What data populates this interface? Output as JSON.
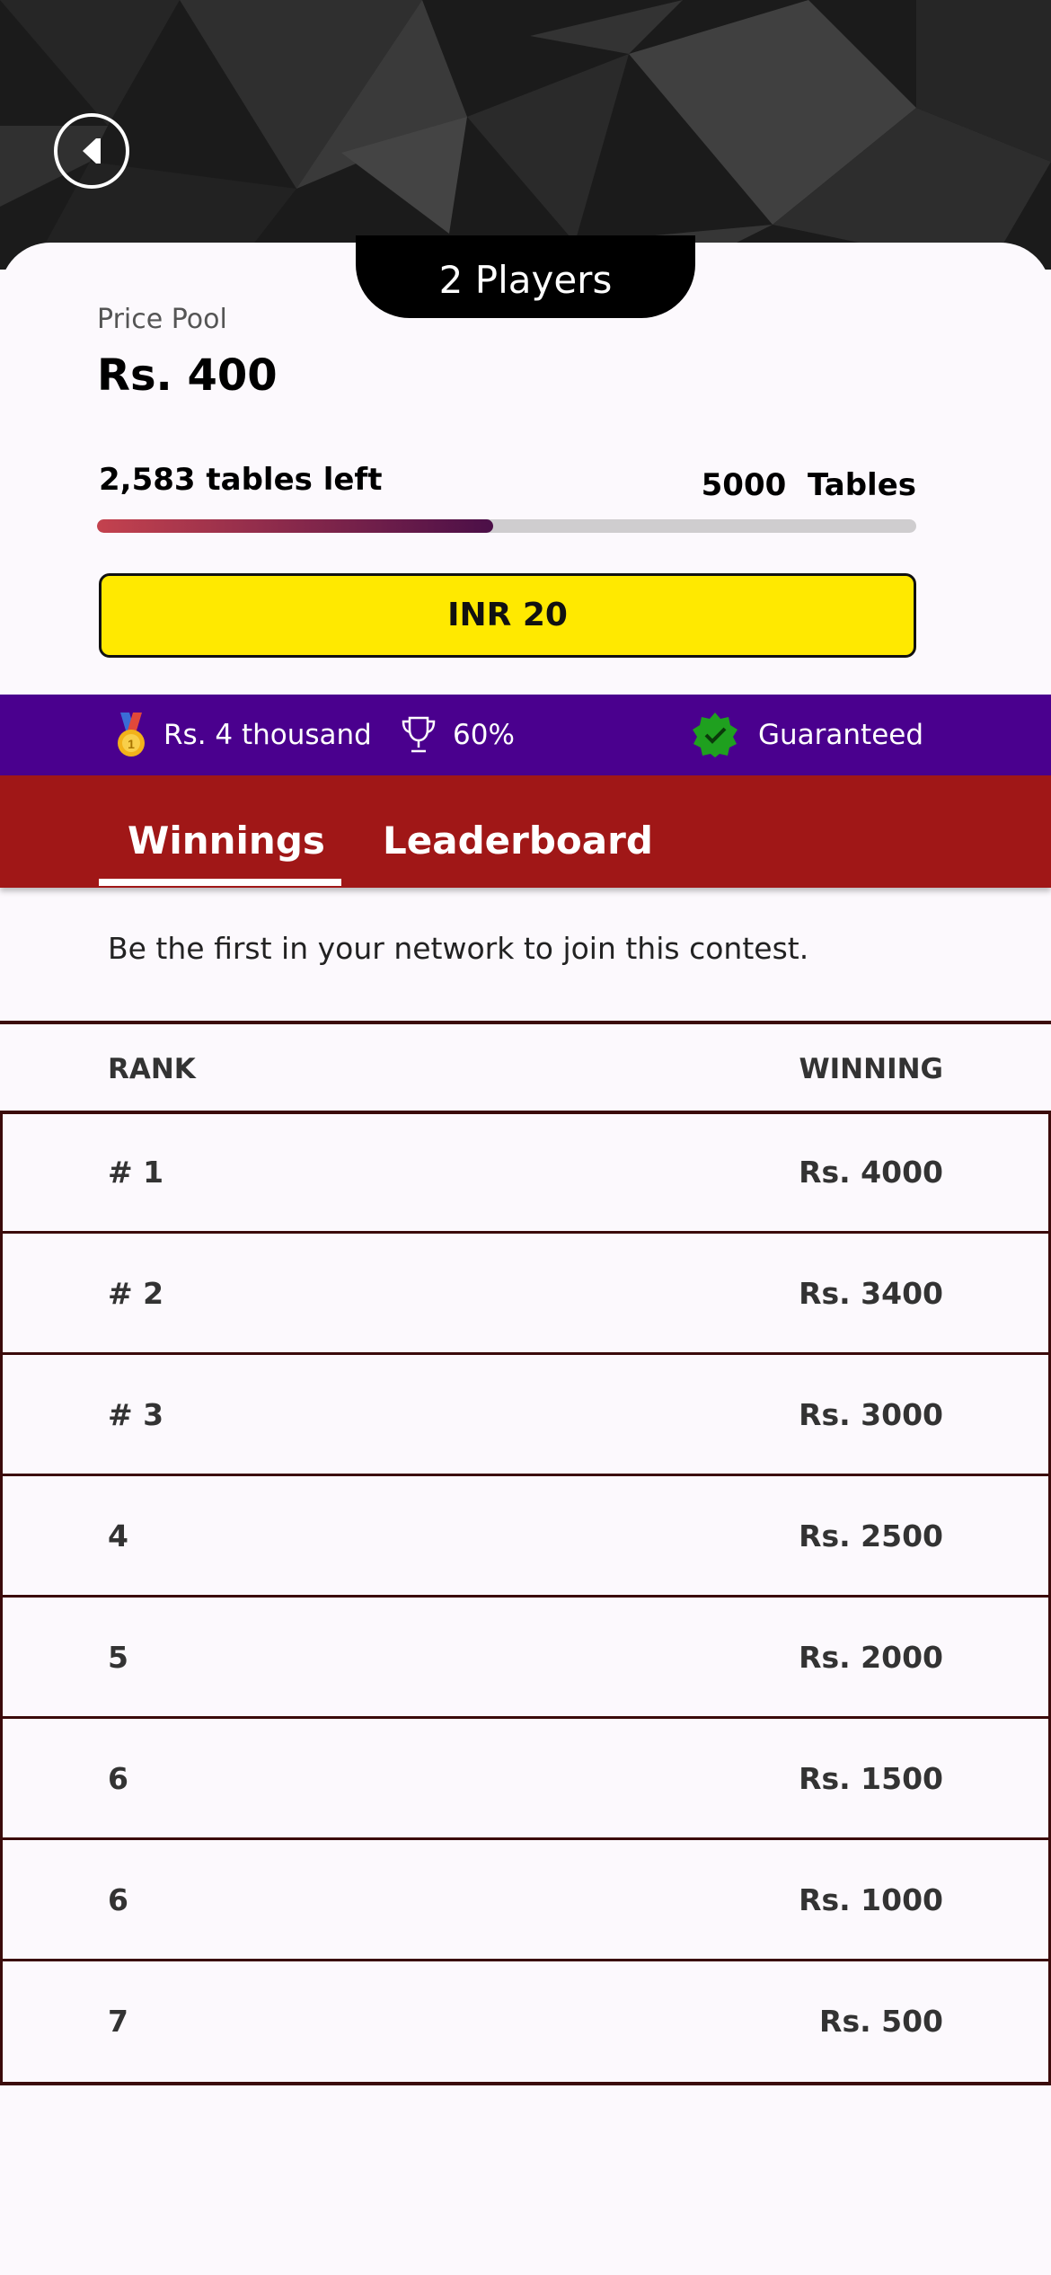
{
  "header": {
    "back_icon": "back-arrow-icon",
    "players_label": "2 Players"
  },
  "contest": {
    "prize_label": "Price Pool",
    "prize_value": "Rs. 400",
    "tables_left": "2,583 tables left",
    "tables_total": "5000  Tables",
    "progress_fraction": 0.484,
    "entry_label": "INR 20"
  },
  "info_strip": {
    "first_prize": "Rs. 4 thousand",
    "first_prize_icon": "medal-icon",
    "winners_percent": "60%",
    "winners_icon": "trophy-icon",
    "guaranteed": "Guaranteed",
    "guaranteed_icon": "verified-badge-icon"
  },
  "tabs": [
    {
      "label": "Winnings",
      "active": true
    },
    {
      "label": "Leaderboard",
      "active": false
    }
  ],
  "network_message": "Be the first in your network to join this contest.",
  "rank_table": {
    "headers": {
      "rank": "RANK",
      "winning": "WINNING"
    },
    "rows": [
      {
        "rank": "# 1",
        "winning": "Rs. 4000"
      },
      {
        "rank": "# 2",
        "winning": "Rs. 3400"
      },
      {
        "rank": "# 3",
        "winning": "Rs. 3000"
      },
      {
        "rank": "4",
        "winning": "Rs. 2500"
      },
      {
        "rank": "5",
        "winning": "Rs. 2000"
      },
      {
        "rank": "6",
        "winning": "Rs. 1500"
      },
      {
        "rank": "6",
        "winning": "Rs. 1000"
      },
      {
        "rank": "7",
        "winning": "Rs. 500"
      }
    ]
  },
  "colors": {
    "tab_bar": "#a01717",
    "info_strip": "#4a008e",
    "entry_button": "#ffe900",
    "progress_start": "#c4424e",
    "progress_end": "#4b0f48",
    "verified_green": "#1fa01f",
    "medal_gold": "#f2b21a"
  }
}
